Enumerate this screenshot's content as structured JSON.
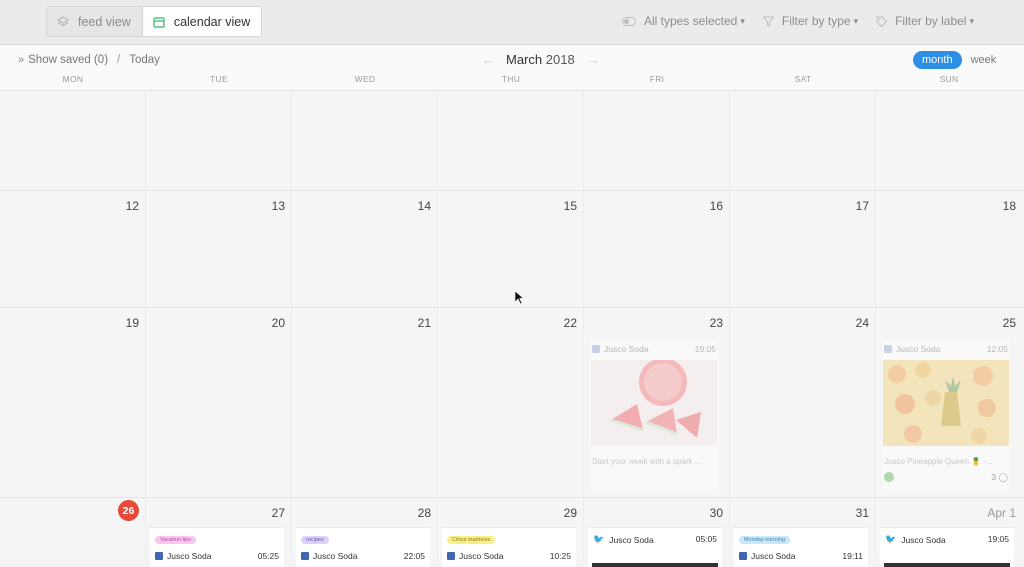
{
  "topbar": {
    "views": [
      {
        "label": "feed view",
        "icon": "layers-icon",
        "active": false
      },
      {
        "label": "calendar view",
        "icon": "calendar-icon",
        "active": true
      }
    ],
    "filters": [
      {
        "label": "All types selected",
        "icon": "toggle-icon"
      },
      {
        "label": "Filter by type",
        "icon": "funnel-icon"
      },
      {
        "label": "Filter by label",
        "icon": "tag-icon"
      }
    ],
    "caret": "▾"
  },
  "subbar": {
    "show_saved": "Show saved (0)",
    "separator": "/",
    "today": "Today",
    "month": "March",
    "year": "2018",
    "prev_arrow": "←",
    "next_arrow": "→",
    "view_month": "month",
    "view_week": "week"
  },
  "weekdays": [
    "MON",
    "TUE",
    "WED",
    "THU",
    "FRI",
    "SAT",
    "SUN"
  ],
  "weeks": [
    {
      "days": [
        "",
        "",
        "",
        "",
        "",
        "",
        ""
      ]
    },
    {
      "days": [
        "12",
        "13",
        "14",
        "15",
        "16",
        "17",
        "18"
      ]
    },
    {
      "days": [
        "19",
        "20",
        "21",
        "22",
        "23",
        "24",
        "25"
      ]
    },
    {
      "days": [
        "26",
        "27",
        "28",
        "29",
        "30",
        "31",
        "Apr 1"
      ]
    }
  ],
  "posts_week3": [
    {
      "day_index": 4,
      "account": "Jusco Soda",
      "time": "19:05",
      "caption": "Start your week with a spark ...",
      "image": "watermelon"
    },
    {
      "day_index": 6,
      "account": "Jusco Soda",
      "time": "12:05",
      "caption": "Jusco Pineapple Queen 🍍 -...",
      "comments": "3",
      "image": "citrus"
    }
  ],
  "posts_week4": [
    {
      "tag": "Vacation tips",
      "tag_color": "#f7c9ef",
      "tag_text": "#b3489f",
      "account": "Jusco Soda",
      "time": "05:25"
    },
    {
      "tag": "recipes",
      "tag_color": "#dcd1f7",
      "tag_text": "#6c52b8",
      "account": "Jusco Soda",
      "time": "22:05"
    },
    {
      "tag": "Citrus madness",
      "tag_color": "#f8ee8a",
      "tag_text": "#8a7b12",
      "account": "Jusco Soda",
      "time": "10:25"
    },
    {
      "twitter": true,
      "account": "Jusco Soda",
      "time": "05:05"
    },
    {
      "tag": "Monday morning",
      "tag_color": "#cbe6f7",
      "tag_text": "#3282b8",
      "account": "Jusco Soda",
      "time": "19:11"
    },
    {
      "twitter": true,
      "account": "Jusco Soda",
      "time": "19:05"
    }
  ],
  "colors": {
    "accent": "#2d8fe3",
    "today": "#e64a3b"
  }
}
